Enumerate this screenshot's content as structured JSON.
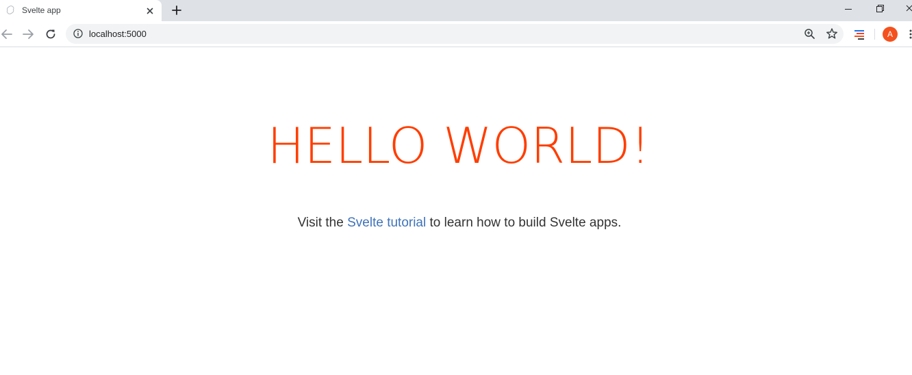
{
  "browser": {
    "tab": {
      "title": "Svelte app",
      "favicon": "svelte-icon"
    },
    "address_bar": {
      "url": "localhost:5000"
    },
    "profile": {
      "initial": "A",
      "color": "#f4511e"
    }
  },
  "page": {
    "heading": "HELLO WORLD!",
    "intro": {
      "before": "Visit the ",
      "link_text": "Svelte tutorial",
      "after": " to learn how to build Svelte apps."
    },
    "colors": {
      "heading": "#ff3e00",
      "link": "#3f73b9",
      "text": "#333333"
    }
  },
  "icons": {
    "back": "arrow-left-icon",
    "forward": "arrow-right-icon",
    "reload": "reload-icon",
    "site_info": "info-icon",
    "zoom": "zoom-icon",
    "bookmark": "star-icon",
    "extension": "extension-icon",
    "menu": "more-vert-icon",
    "new_tab": "plus-icon",
    "close_tab": "close-icon",
    "minimize": "minimize-icon",
    "restore": "restore-icon",
    "close_window": "close-icon"
  }
}
